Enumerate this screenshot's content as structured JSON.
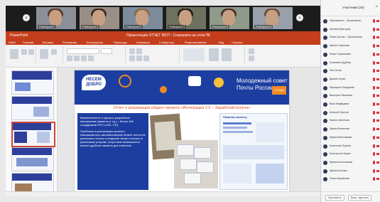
{
  "video_strip": {
    "tiles": [
      {
        "name": "Participant 1"
      },
      {
        "name": "Participant 2"
      },
      {
        "name": "Participant 3"
      },
      {
        "name": "Participant 4"
      },
      {
        "name": "Participant 5"
      },
      {
        "name": "Participant 6"
      }
    ]
  },
  "powerpoint": {
    "app": "PowerPoint",
    "doc_title": "Презентация ОТЧЕТ МСП - Сохранено на этом ПК",
    "tabs": [
      "Файл",
      "Главная",
      "Вставка",
      "Рисование",
      "Конструктор",
      "Переходы",
      "Анимация",
      "Слайд-шоу",
      "Рецензирование",
      "Вид",
      "Справка"
    ]
  },
  "slide": {
    "logo_text": "НЕСЕМ ДОБРО",
    "council_title": "Молодежный совет Почты России",
    "badge": "4 ГОДА",
    "report_title": "Отчет о реализации общего проекта «Интеграция 2.0 – Заработай-получи»",
    "box_par1": "Вовлеченность в процесс разработки материалов (памяток и т.д.) – более 460 сотрудников ОПС и МС, НП).",
    "box_par2": "Проблемы в реализации проекта: невозможность автоматической печати текста на различных листах и создание своих отчетов по различным услугам, отсутствие возможности печати удобных памяток для клиентов.",
    "poster_head": "Памятка клиенту"
  },
  "chat": {
    "title": "Участники (20)",
    "participants": [
      "Пархоменко – Организатор",
      "Кутлина Виктория",
      "Юлия Кутина – Организатор",
      "Ирина Семенова",
      "Юлия Герасимова",
      "Елизавета Дубова",
      "Ион Уссов",
      "Даниил Кузин",
      "Маргарита Федорова",
      "Виктория Яковлева",
      "Вика Медведева",
      "Алексей Орехов",
      "Кирилл Шелепов",
      "Ирина Шелепова",
      "Ирина Мельникова",
      "Анастасия Зорина",
      "Константин Кожин",
      "Ирина Колесникова",
      "Ирина Козлова",
      "Ольга Кирсанова"
    ],
    "foot_btn1": "Пригласить",
    "foot_btn2": "Выкл. звук всех"
  }
}
